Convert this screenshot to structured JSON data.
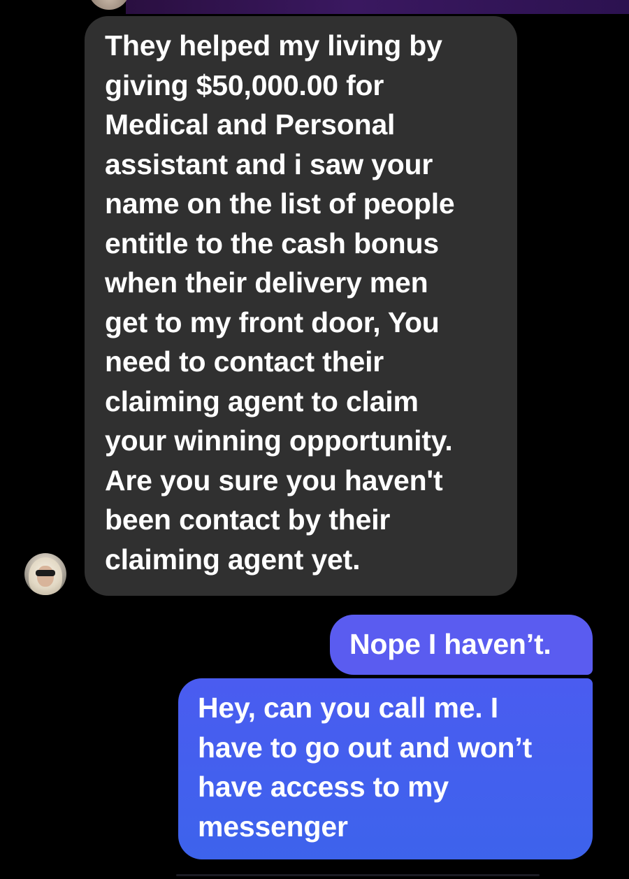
{
  "thread": {
    "messages": [
      {
        "direction": "incoming",
        "text": "They helped my living by\ngiving $50,000.00 for\nMedical and Personal\nassistant and i saw your\nname on the list of people\nentitle to the cash bonus\nwhen their delivery men\nget to my front door, You\nneed to contact their\nclaiming agent to claim\nyour winning opportunity.\nAre you sure you haven't\nbeen contact by their\nclaiming agent yet."
      },
      {
        "direction": "outgoing",
        "text": "Nope I haven’t."
      },
      {
        "direction": "outgoing",
        "text": "Hey, can you call me. I\nhave to go out and won’t\nhave access to my\nmessenger"
      }
    ]
  },
  "colors": {
    "background": "#000000",
    "incoming_bubble": "#303030",
    "outgoing_bubble": "#5a5cf0",
    "text": "#ffffff"
  },
  "icons": {
    "sender_avatar": "contact-avatar-photo"
  }
}
